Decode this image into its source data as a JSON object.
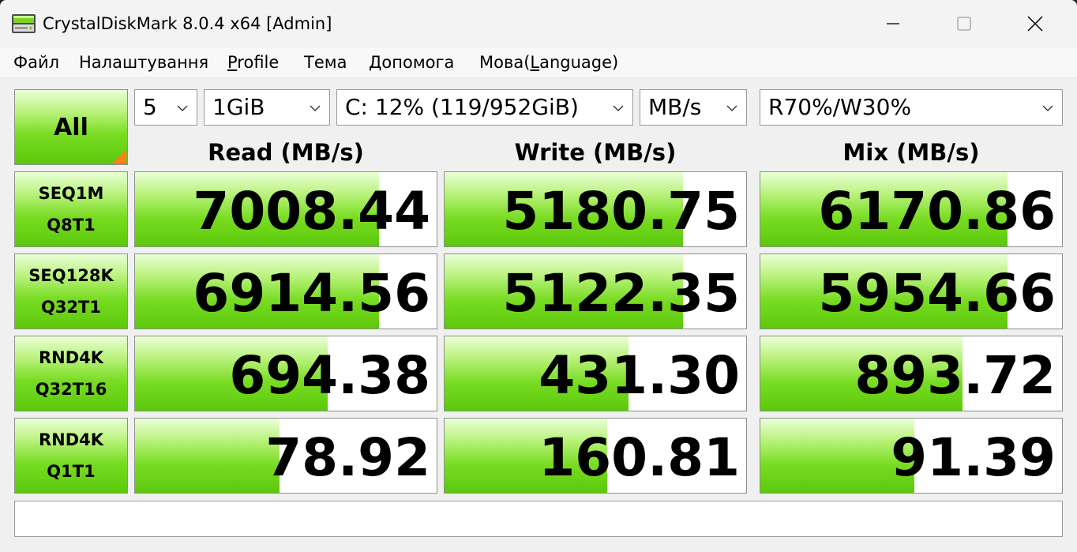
{
  "window": {
    "title": "CrystalDiskMark 8.0.4 x64 [Admin]"
  },
  "menu": [
    {
      "label": "Файл"
    },
    {
      "label": "Налаштування"
    },
    {
      "pre": "",
      "accel": "P",
      "post": "rofile"
    },
    {
      "label": "Тема"
    },
    {
      "label": "Допомога"
    },
    {
      "pre": "Мова(",
      "accel": "L",
      "post": "anguage)"
    }
  ],
  "controls": {
    "all_label": "All",
    "count": "5",
    "size": "1GiB",
    "drive": "C: 12% (119/952GiB)",
    "unit": "MB/s",
    "mix": "R70%/W30%"
  },
  "headers": {
    "read": "Read (MB/s)",
    "write": "Write (MB/s)",
    "mix": "Mix (MB/s)"
  },
  "rows": [
    {
      "line1": "SEQ1M",
      "line2": "Q8T1",
      "read": {
        "text": "7008.44",
        "fill": 0.81
      },
      "write": {
        "text": "5180.75",
        "fill": 0.79
      },
      "mix": {
        "text": "6170.86",
        "fill": 0.82
      }
    },
    {
      "line1": "SEQ128K",
      "line2": "Q32T1",
      "read": {
        "text": "6914.56",
        "fill": 0.81
      },
      "write": {
        "text": "5122.35",
        "fill": 0.79
      },
      "mix": {
        "text": "5954.66",
        "fill": 0.82
      }
    },
    {
      "line1": "RND4K",
      "line2": "Q32T16",
      "read": {
        "text": "694.38",
        "fill": 0.64
      },
      "write": {
        "text": "431.30",
        "fill": 0.61
      },
      "mix": {
        "text": "893.72",
        "fill": 0.67
      }
    },
    {
      "line1": "RND4K",
      "line2": "Q1T1",
      "read": {
        "text": "78.92",
        "fill": 0.48
      },
      "write": {
        "text": "160.81",
        "fill": 0.54
      },
      "mix": {
        "text": "91.39",
        "fill": 0.51
      }
    }
  ],
  "comment": "",
  "colors": {
    "accent_green": "#5cc80c",
    "corner_orange": "#ff7f1e"
  },
  "icons": {
    "app": "crystaldiskmark-app-icon",
    "dropdown": "chevron-down-icon",
    "minimize": "minimize-icon",
    "maximize": "maximize-icon",
    "close": "close-icon"
  }
}
